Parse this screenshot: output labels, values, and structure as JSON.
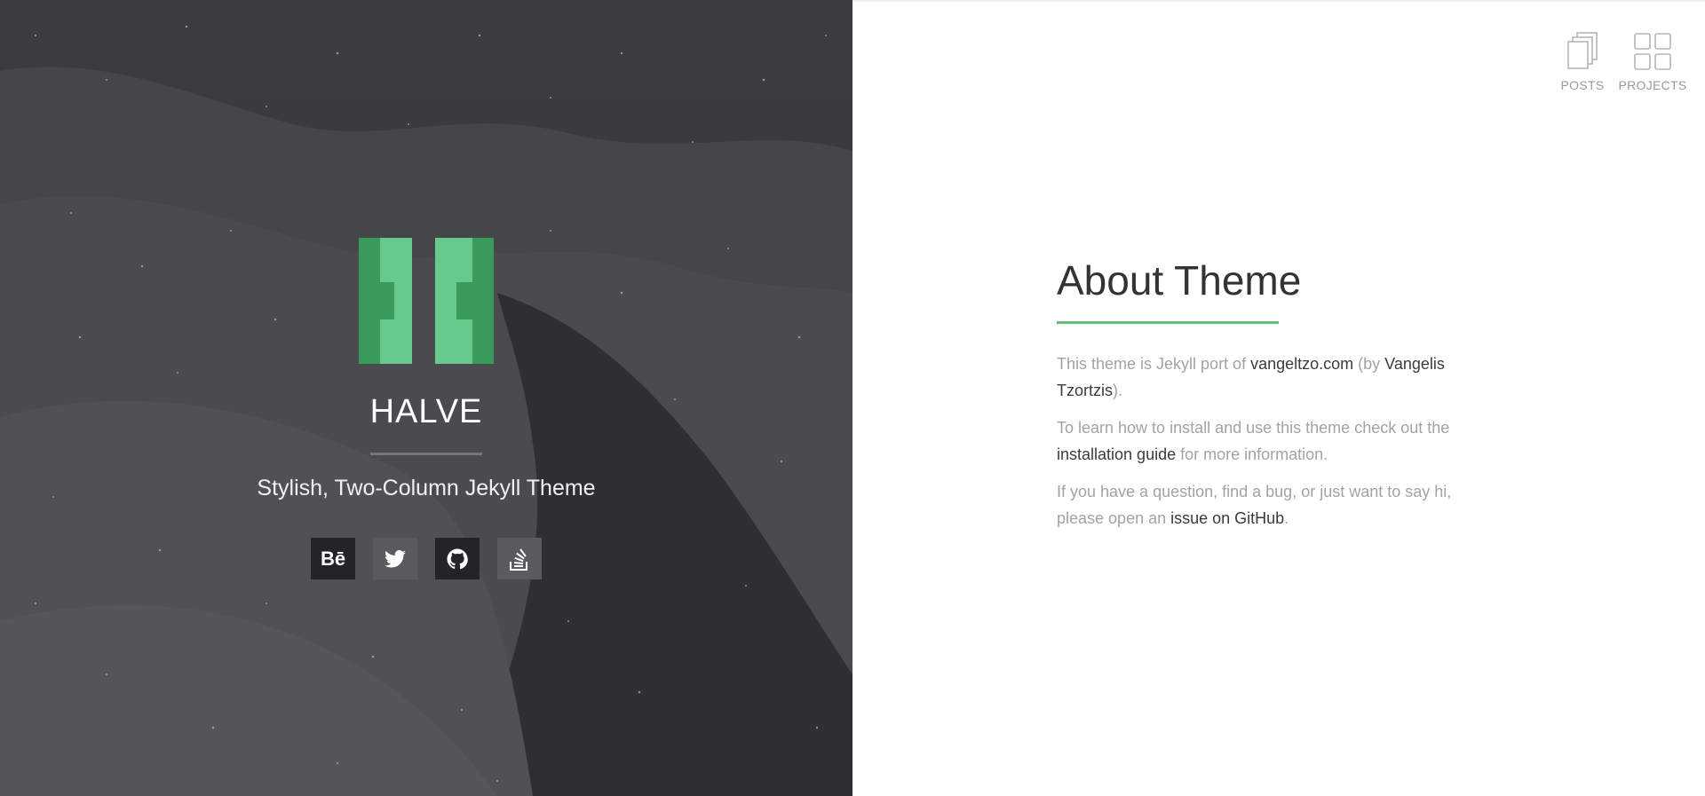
{
  "hero": {
    "title": "HALVE",
    "tagline": "Stylish, Two-Column Jekyll Theme",
    "logo_colors": [
      "#3a9a5c",
      "#66c98d"
    ],
    "social": [
      {
        "icon": "behance-icon",
        "label": "Bē"
      },
      {
        "icon": "twitter-icon",
        "label": ""
      },
      {
        "icon": "github-icon",
        "label": ""
      },
      {
        "icon": "stackoverflow-icon",
        "label": ""
      }
    ]
  },
  "nav": {
    "posts_label": "POSTS",
    "projects_label": "PROJECTS"
  },
  "about": {
    "title": "About Theme",
    "accent_color": "#5ebf79",
    "p1_a": "This theme is Jekyll port of ",
    "p1_link1": "vangeltzo.com",
    "p1_b": " (by ",
    "p1_link2": "Vangelis Tzortzis",
    "p1_c": ").",
    "p2_a": "To learn how to install and use this theme check out the ",
    "p2_link": "installation guide",
    "p2_b": " for more information.",
    "p3_a": "If you have a question, find a bug, or just want to say hi, please open an ",
    "p3_link": "issue on GitHub",
    "p3_b": "."
  }
}
